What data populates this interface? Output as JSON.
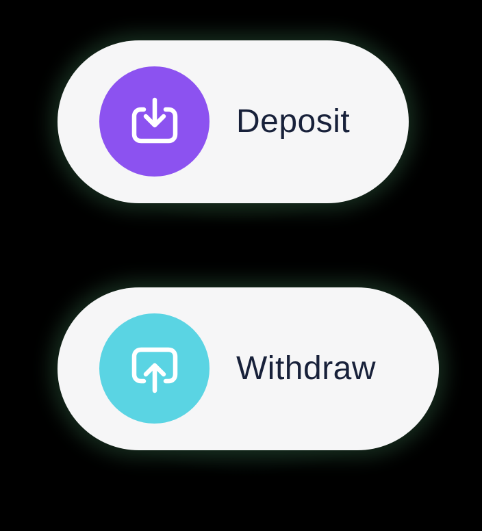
{
  "actions": [
    {
      "id": "deposit",
      "label": "Deposit",
      "icon": "deposit-icon",
      "color": "#8c52f0"
    },
    {
      "id": "withdraw",
      "label": "Withdraw",
      "icon": "withdraw-icon",
      "color": "#5ad4e3"
    }
  ]
}
